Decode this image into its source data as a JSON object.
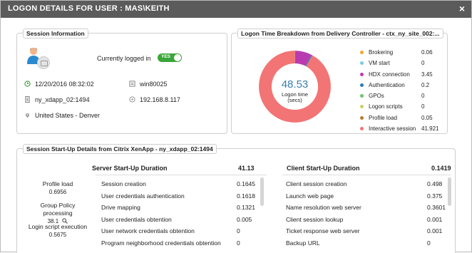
{
  "dialog": {
    "title": "LOGON DETAILS FOR USER : MAS\\KEITH",
    "close": "×"
  },
  "session": {
    "title": "Session Information",
    "logged_label": "Currently logged in",
    "toggle": "YES",
    "datetime": "12/20/2016 08:32:02",
    "machine": "win80025",
    "delivery": "ny_xdapp_02:1494",
    "ip": "192.168.8.117",
    "location": "United States - Denver"
  },
  "breakdown": {
    "title": "Logon Time Breakdown from Delivery Controller - ctx_ny_site_002:...",
    "total_value": "48.53",
    "total_label_1": "Logon time",
    "total_label_2": "(secs)",
    "items": [
      {
        "name": "Brokering",
        "value": "0.06",
        "color": "#f0a830"
      },
      {
        "name": "VM start",
        "value": "0",
        "color": "#7ec8e8"
      },
      {
        "name": "HDX connection",
        "value": "3.45",
        "color": "#b83cb0"
      },
      {
        "name": "Authentication",
        "value": "0.2",
        "color": "#2b7bb9"
      },
      {
        "name": "GPOs",
        "value": "0",
        "color": "#6fc36b"
      },
      {
        "name": "Logon scripts",
        "value": "0",
        "color": "#cfcf6a"
      },
      {
        "name": "Profile load",
        "value": "0.05",
        "color": "#b87a30"
      },
      {
        "name": "Interactive session",
        "value": "41.921",
        "color": "#f27474"
      }
    ]
  },
  "startup": {
    "title": "Session Start-Up Details from Citrix XenApp - ny_xdapp_02:1494",
    "side": [
      {
        "label": "Profile load",
        "value": "0.6956"
      },
      {
        "label": "Group Policy processing",
        "value": "38.1"
      },
      {
        "label": "Login script execution",
        "value": "0.5675"
      }
    ],
    "server": {
      "title": "Server Start-Up Duration",
      "total": "41.13",
      "rows": [
        {
          "name": "Session creation",
          "value": "0.1645"
        },
        {
          "name": "User credentials authentication",
          "value": "0.1618"
        },
        {
          "name": "Drive mapping",
          "value": "0.1321"
        },
        {
          "name": "User credentials obtention",
          "value": "0.005"
        },
        {
          "name": "User network credentials obtention",
          "value": "0"
        },
        {
          "name": "Program neighborhood credentials obtention",
          "value": "0"
        }
      ]
    },
    "client": {
      "title": "Client Start-Up Duration",
      "total": "0.1419",
      "rows": [
        {
          "name": "Client session creation",
          "value": "0.498"
        },
        {
          "name": "Launch web page",
          "value": "0.375"
        },
        {
          "name": "Name resolution web server",
          "value": "0.3601"
        },
        {
          "name": "Client session lookup",
          "value": "0.001"
        },
        {
          "name": "Ticket response web server",
          "value": "0.001"
        },
        {
          "name": "Backup URL",
          "value": "0"
        }
      ]
    }
  }
}
